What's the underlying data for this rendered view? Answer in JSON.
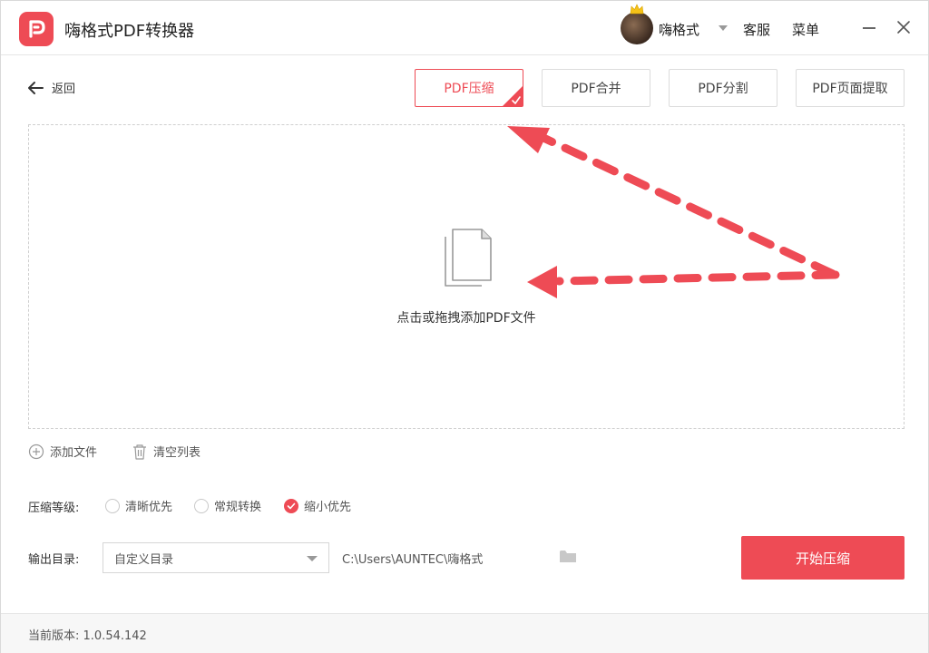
{
  "app": {
    "title": "嗨格式PDF转换器"
  },
  "header": {
    "username": "嗨格式",
    "service": "客服",
    "menu": "菜单"
  },
  "nav": {
    "back_label": "返回"
  },
  "tabs": [
    {
      "label": "PDF压缩",
      "active": true
    },
    {
      "label": "PDF合并",
      "active": false
    },
    {
      "label": "PDF分割",
      "active": false
    },
    {
      "label": "PDF页面提取",
      "active": false
    }
  ],
  "dropzone": {
    "hint": "点击或拖拽添加PDF文件"
  },
  "file_actions": {
    "add": "添加文件",
    "clear": "清空列表"
  },
  "compression": {
    "label": "压缩等级:",
    "options": [
      {
        "label": "清晰优先",
        "selected": false
      },
      {
        "label": "常规转换",
        "selected": false
      },
      {
        "label": "缩小优先",
        "selected": true
      }
    ]
  },
  "output": {
    "label": "输出目录:",
    "selected": "自定义目录",
    "path": "C:\\Users\\AUNTEC\\嗨格式"
  },
  "actions": {
    "start": "开始压缩"
  },
  "footer": {
    "version": "当前版本: 1.0.54.142"
  },
  "colors": {
    "accent": "#ee4b55",
    "annotation_arrow": "#ee4b55"
  },
  "icons": [
    "app-logo-icon",
    "crown-icon",
    "back-arrow-icon",
    "check-corner-icon",
    "document-icon",
    "add-circle-icon",
    "trash-icon",
    "folder-icon",
    "close-icon",
    "minimize-icon"
  ]
}
